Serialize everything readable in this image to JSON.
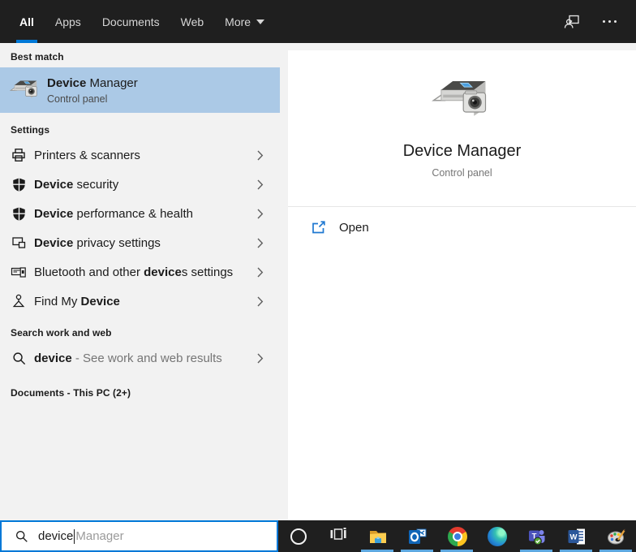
{
  "header": {
    "tabs": [
      {
        "label": "All",
        "active": true
      },
      {
        "label": "Apps",
        "active": false
      },
      {
        "label": "Documents",
        "active": false
      },
      {
        "label": "Web",
        "active": false
      },
      {
        "label": "More",
        "active": false,
        "has_dropdown": true
      }
    ],
    "right_icons": [
      "user-account-icon",
      "more-options-icon"
    ]
  },
  "left": {
    "best_match_header": "Best match",
    "best_match": {
      "icon": "device-manager-icon",
      "title_match": "Device",
      "title_rest": " Manager",
      "subtitle": "Control panel"
    },
    "settings_header": "Settings",
    "settings_items": [
      {
        "icon": "printer-icon",
        "pre": "Printers & scanners",
        "match": "",
        "post": ""
      },
      {
        "icon": "defender-shield-icon",
        "pre": "",
        "match": "Device",
        "post": " security"
      },
      {
        "icon": "defender-shield-icon",
        "pre": "",
        "match": "Device",
        "post": " performance & health"
      },
      {
        "icon": "devices-privacy-icon",
        "pre": "",
        "match": "Device",
        "post": " privacy settings"
      },
      {
        "icon": "keyboard-phone-icon",
        "pre": "Bluetooth and other ",
        "match": "device",
        "post": "s settings"
      },
      {
        "icon": "map-pin-icon",
        "pre": "Find My ",
        "match": "Device",
        "post": ""
      }
    ],
    "search_web_header": "Search work and web",
    "web_search": {
      "icon": "search-icon",
      "query": "device",
      "hint": " - See work and web results"
    },
    "documents_header": "Documents - This PC (2+)"
  },
  "preview": {
    "icon": "device-manager-icon",
    "title": "Device Manager",
    "subtitle": "Control panel",
    "open_action": {
      "icon": "open-external-icon",
      "label": "Open"
    }
  },
  "search_box": {
    "icon": "search-icon",
    "query": "device",
    "suggestion": "Manager"
  },
  "taskbar": {
    "items": [
      {
        "icon": "cortana-icon",
        "running": false
      },
      {
        "icon": "task-view-icon",
        "running": false
      },
      {
        "icon": "file-explorer-icon",
        "running": true
      },
      {
        "icon": "outlook-icon",
        "running": true
      },
      {
        "icon": "chrome-icon",
        "running": true
      },
      {
        "icon": "edge-icon",
        "running": false
      },
      {
        "icon": "teams-icon",
        "running": true
      },
      {
        "icon": "word-icon",
        "running": true
      },
      {
        "icon": "paint-icon",
        "running": true
      }
    ]
  },
  "colors": {
    "accent": "#0078d7",
    "highlight": "#abc9e6",
    "topbar_bg": "#1f1f1f",
    "panel_bg": "#f2f2f2",
    "running_indicator": "#5da8e0"
  }
}
